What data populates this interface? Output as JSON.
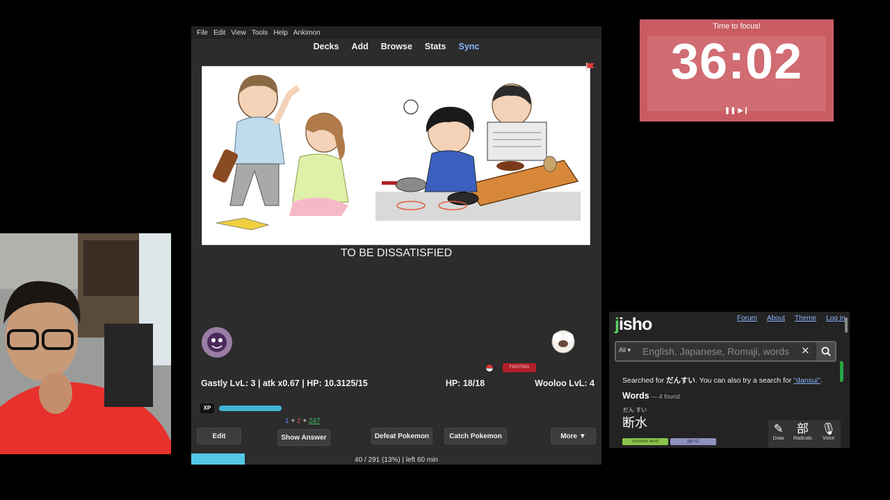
{
  "anki": {
    "menu": [
      "File",
      "Edit",
      "View",
      "Tools",
      "Help",
      "Ankimon"
    ],
    "toolbar": {
      "decks": "Decks",
      "add": "Add",
      "browse": "Browse",
      "stats": "Stats",
      "sync": "Sync"
    },
    "card_text": "TO BE DISSATISFIED",
    "battle": {
      "player_stats": "Gastly LvL: 3 | atk x0.67 |",
      "player_hp": "HP: 10.3125/15",
      "enemy_hp": "HP: 18/18",
      "enemy_name": "Wooloo LvL: 4",
      "status_badge": "FIGHTING",
      "xp_label": "XP",
      "xp_progress": 0.3
    },
    "counts": {
      "new": "1",
      "plus1": "+",
      "learn": "2",
      "plus2": "+",
      "review": "247"
    },
    "buttons": {
      "edit": "Edit",
      "show_answer": "Show Answer",
      "defeat": "Defeat Pokemon",
      "catch": "Catch Pokemon",
      "more": "More ▼"
    },
    "progress_text": "40 / 291 (13%) | left 60 min",
    "progress_fraction": 0.13
  },
  "timer": {
    "title": "Time to focus!",
    "time": "36:02",
    "controls": "❚❚ ▶❙"
  },
  "jisho": {
    "logo_j": "j",
    "logo_rest": "isho",
    "nav": [
      "Forum",
      "About",
      "Theme",
      "Log in"
    ],
    "search_scope": "All ▾",
    "search_placeholder": "English, Japanese, Romaji, words",
    "searched_prefix": "Searched for ",
    "searched_term": "だんすい",
    "searched_mid": ". You can also try a search for ",
    "searched_alt": "\"dansui\"",
    "searched_end": ".",
    "words_heading": "Words",
    "words_found": " — 4 found",
    "furigana": "だん すい",
    "word": "断水",
    "tags": [
      "common word",
      "jlpt n2"
    ],
    "tools": [
      {
        "icon": "✎",
        "label": "Draw"
      },
      {
        "icon": "部",
        "label": "Radicals"
      },
      {
        "icon": "🎙",
        "label": "Voice"
      }
    ]
  }
}
